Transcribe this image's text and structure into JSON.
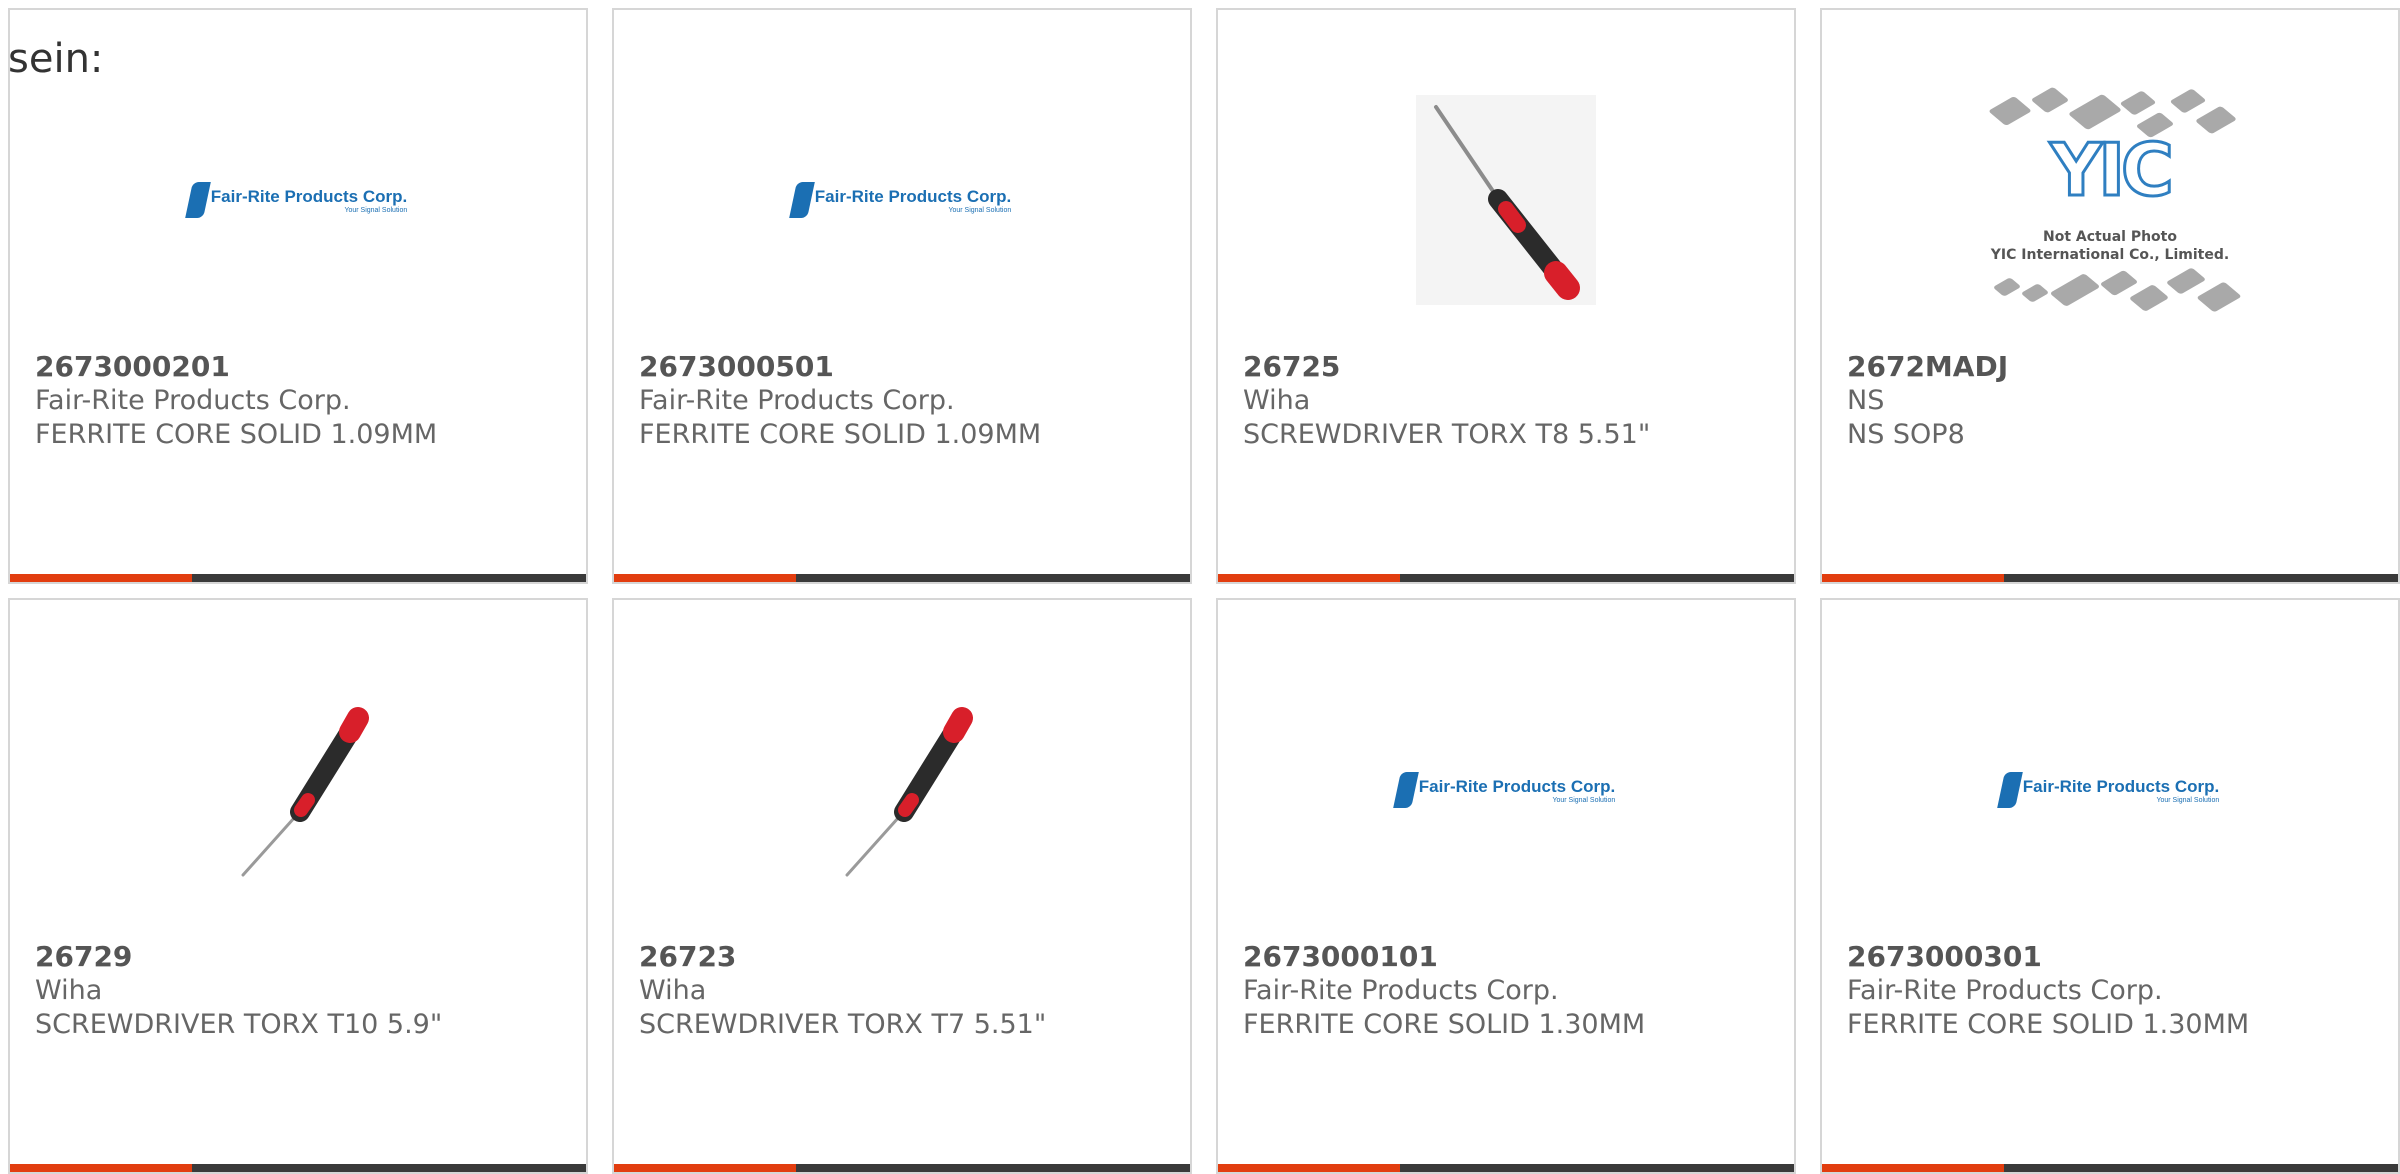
{
  "intro_text": "sein:",
  "colors": {
    "accent": "#e23d0f",
    "bar": "#3a3a3a",
    "fairrite_blue": "#1b6fb3",
    "driver_red": "#d81f2a"
  },
  "products": [
    {
      "part_number": "2673000201",
      "manufacturer": "Fair-Rite Products Corp.",
      "description": "FERRITE CORE SOLID 1.09MM",
      "image": "fair-rite-logo"
    },
    {
      "part_number": "2673000501",
      "manufacturer": "Fair-Rite Products Corp.",
      "description": "FERRITE CORE SOLID 1.09MM",
      "image": "fair-rite-logo"
    },
    {
      "part_number": "26725",
      "manufacturer": "Wiha",
      "description": "SCREWDRIVER TORX T8 5.51\"",
      "image": "screwdriver-photo"
    },
    {
      "part_number": "2672MADJ",
      "manufacturer": "NS",
      "description": "NS SOP8",
      "image": "yic-placeholder"
    },
    {
      "part_number": "26729",
      "manufacturer": "Wiha",
      "description": "SCREWDRIVER TORX T10 5.9\"",
      "image": "screwdriver-photo"
    },
    {
      "part_number": "26723",
      "manufacturer": "Wiha",
      "description": "SCREWDRIVER TORX T7 5.51\"",
      "image": "screwdriver-photo"
    },
    {
      "part_number": "2673000101",
      "manufacturer": "Fair-Rite Products Corp.",
      "description": "FERRITE CORE SOLID 1.30MM",
      "image": "fair-rite-logo"
    },
    {
      "part_number": "2673000301",
      "manufacturer": "Fair-Rite Products Corp.",
      "description": "FERRITE CORE SOLID 1.30MM",
      "image": "fair-rite-logo"
    }
  ],
  "logo_text": {
    "fair_rite_name": "Fair-Rite Products Corp.",
    "fair_rite_tagline": "Your Signal Solution",
    "yic_letters": "YIC",
    "yic_note_line1": "Not Actual Photo",
    "yic_note_line2": "YIC International Co., Limited."
  }
}
